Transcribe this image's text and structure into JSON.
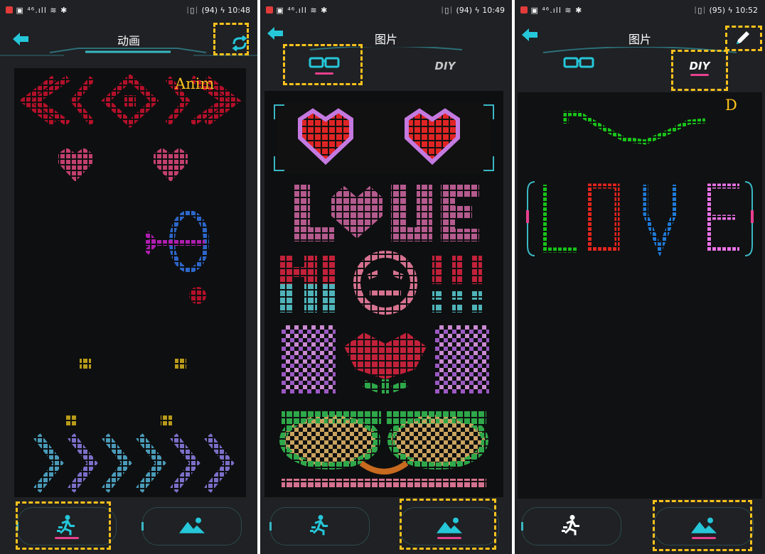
{
  "screens": [
    {
      "status": {
        "left": "▣ ⁴⁶.ıll ≋ ✱",
        "right": "ᛁ▯ᛁ (94) ϟ 10:48"
      },
      "title": "动画",
      "annotation": "Anim",
      "nav": {
        "active": "animation"
      }
    },
    {
      "status": {
        "left": "▣ ⁴⁶.ıll ≋ ✱",
        "right": "ᛁ▯ᛁ (94) ϟ 10:49"
      },
      "title": "图片",
      "tabs": {
        "active": "glasses",
        "diy_label": "DIY"
      },
      "nav": {
        "active": "picture"
      }
    },
    {
      "status": {
        "left": "▣ ⁴⁶.ıll ≋ ✱",
        "right": "ᛁ▯ᛁ (95) ϟ 10:52"
      },
      "title": "图片",
      "tabs": {
        "active": "diy",
        "diy_label": "DIY"
      },
      "annotation": "D",
      "nav": {
        "active": "picture"
      }
    }
  ],
  "colors": {
    "accent": "#25c7d9",
    "highlight": "#ffc21c",
    "indicator": "#e8408f",
    "background": "#1f2124"
  },
  "icons": [
    "back-arrow-icon",
    "loop-icon",
    "edit-pencil-icon",
    "glasses-icon",
    "running-man-icon",
    "mountain-picture-icon"
  ]
}
